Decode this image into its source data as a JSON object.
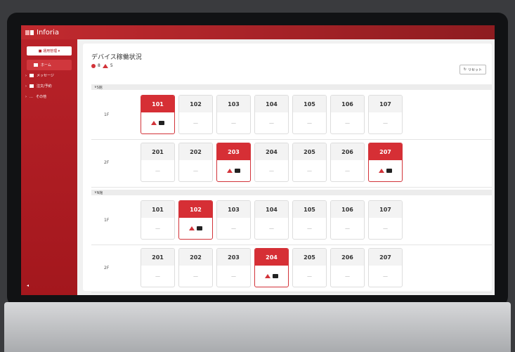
{
  "app": {
    "title": "Inforia"
  },
  "sidebar": {
    "select_label": "■ 運用管理 ▾",
    "items": [
      {
        "label": "ホーム",
        "active": true
      },
      {
        "label": "メッセージ"
      },
      {
        "label": "注文/予約"
      },
      {
        "label": "その他"
      }
    ],
    "collapse_glyph": "◂"
  },
  "page": {
    "title": "デバイス稼働状況",
    "error_count": "8",
    "warning_count": "5",
    "reset_label": "リセット"
  },
  "buildings": [
    {
      "name": "S館",
      "floors": [
        {
          "label": "1F",
          "rooms": [
            {
              "num": "101",
              "status": "alert"
            },
            {
              "num": "102",
              "status": "ok"
            },
            {
              "num": "103",
              "status": "ok"
            },
            {
              "num": "104",
              "status": "ok"
            },
            {
              "num": "105",
              "status": "ok"
            },
            {
              "num": "106",
              "status": "ok"
            },
            {
              "num": "107",
              "status": "ok"
            }
          ]
        },
        {
          "label": "2F",
          "rooms": [
            {
              "num": "201",
              "status": "ok"
            },
            {
              "num": "202",
              "status": "ok"
            },
            {
              "num": "203",
              "status": "alert"
            },
            {
              "num": "204",
              "status": "ok"
            },
            {
              "num": "205",
              "status": "ok"
            },
            {
              "num": "206",
              "status": "ok"
            },
            {
              "num": "207",
              "status": "alert"
            }
          ]
        }
      ]
    },
    {
      "name": "N館",
      "floors": [
        {
          "label": "1F",
          "rooms": [
            {
              "num": "101",
              "status": "ok"
            },
            {
              "num": "102",
              "status": "alert"
            },
            {
              "num": "103",
              "status": "ok"
            },
            {
              "num": "104",
              "status": "ok"
            },
            {
              "num": "105",
              "status": "ok"
            },
            {
              "num": "106",
              "status": "ok"
            },
            {
              "num": "107",
              "status": "ok"
            }
          ]
        },
        {
          "label": "2F",
          "rooms": [
            {
              "num": "201",
              "status": "ok"
            },
            {
              "num": "202",
              "status": "ok"
            },
            {
              "num": "203",
              "status": "ok"
            },
            {
              "num": "204",
              "status": "alert"
            },
            {
              "num": "205",
              "status": "ok"
            },
            {
              "num": "206",
              "status": "ok"
            },
            {
              "num": "207",
              "status": "ok"
            }
          ]
        }
      ]
    }
  ],
  "empty_status_text": "—",
  "colors": {
    "brand": "#c22a2f",
    "alert": "#d62f35"
  }
}
